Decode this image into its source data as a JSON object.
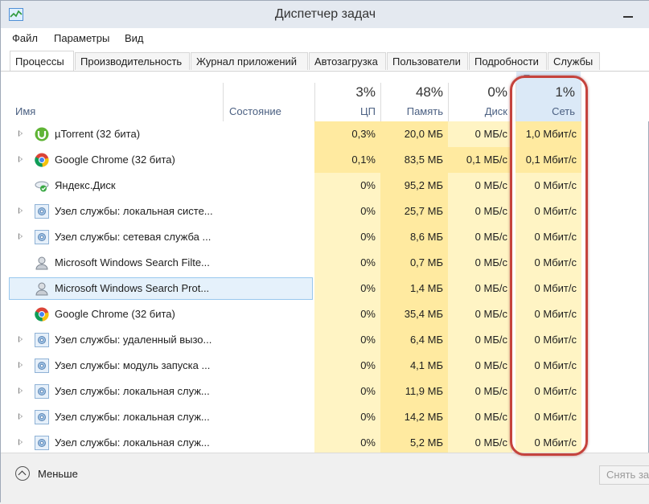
{
  "window": {
    "title": "Диспетчер задач"
  },
  "menu": [
    "Файл",
    "Параметры",
    "Вид"
  ],
  "tabs": [
    "Процессы",
    "Производительность",
    "Журнал приложений",
    "Автозагрузка",
    "Пользователи",
    "Подробности",
    "Службы"
  ],
  "columns": {
    "name": "Имя",
    "status": "Состояние",
    "cpu": {
      "percent": "3%",
      "label": "ЦП"
    },
    "memory": {
      "percent": "48%",
      "label": "Память"
    },
    "disk": {
      "percent": "0%",
      "label": "Диск"
    },
    "network": {
      "percent": "1%",
      "label": "Сеть"
    }
  },
  "processes": [
    {
      "name": "µTorrent (32 бита)",
      "cpu": "0,3%",
      "memory": "20,0 МБ",
      "disk": "0 МБ/с",
      "network": "1,0 Мбит/с",
      "icon": "utorrent-icon",
      "expandable": true
    },
    {
      "name": "Google Chrome (32 бита)",
      "cpu": "0,1%",
      "memory": "83,5 МБ",
      "disk": "0,1 МБ/с",
      "network": "0,1 Мбит/с",
      "icon": "chrome-icon",
      "expandable": true
    },
    {
      "name": "Яндекс.Диск",
      "cpu": "0%",
      "memory": "95,2 МБ",
      "disk": "0 МБ/с",
      "network": "0 Мбит/с",
      "icon": "yandex-disk-icon",
      "expandable": false
    },
    {
      "name": "Узел службы: локальная систе...",
      "cpu": "0%",
      "memory": "25,7 МБ",
      "disk": "0 МБ/с",
      "network": "0 Мбит/с",
      "icon": "service-host-icon",
      "expandable": true
    },
    {
      "name": "Узел службы: сетевая служба ...",
      "cpu": "0%",
      "memory": "8,6 МБ",
      "disk": "0 МБ/с",
      "network": "0 Мбит/с",
      "icon": "service-host-icon",
      "expandable": true
    },
    {
      "name": "Microsoft Windows Search Filte...",
      "cpu": "0%",
      "memory": "0,7 МБ",
      "disk": "0 МБ/с",
      "network": "0 Мбит/с",
      "icon": "search-user-icon",
      "expandable": false
    },
    {
      "name": "Microsoft Windows Search Prot...",
      "cpu": "0%",
      "memory": "1,4 МБ",
      "disk": "0 МБ/с",
      "network": "0 Мбит/с",
      "icon": "search-user-icon",
      "expandable": false,
      "selected": true
    },
    {
      "name": "Google Chrome (32 бита)",
      "cpu": "0%",
      "memory": "35,4 МБ",
      "disk": "0 МБ/с",
      "network": "0 Мбит/с",
      "icon": "chrome-icon",
      "expandable": false
    },
    {
      "name": "Узел службы: удаленный вызо...",
      "cpu": "0%",
      "memory": "6,4 МБ",
      "disk": "0 МБ/с",
      "network": "0 Мбит/с",
      "icon": "service-host-icon",
      "expandable": true
    },
    {
      "name": "Узел службы: модуль запуска ...",
      "cpu": "0%",
      "memory": "4,1 МБ",
      "disk": "0 МБ/с",
      "network": "0 Мбит/с",
      "icon": "service-host-icon",
      "expandable": true
    },
    {
      "name": "Узел службы: локальная служ...",
      "cpu": "0%",
      "memory": "11,9 МБ",
      "disk": "0 МБ/с",
      "network": "0 Мбит/с",
      "icon": "service-host-icon",
      "expandable": true
    },
    {
      "name": "Узел службы: локальная служ...",
      "cpu": "0%",
      "memory": "14,2 МБ",
      "disk": "0 МБ/с",
      "network": "0 Мбит/с",
      "icon": "service-host-icon",
      "expandable": true
    },
    {
      "name": "Узел службы: локальная служ...",
      "cpu": "0%",
      "memory": "5,2 МБ",
      "disk": "0 МБ/с",
      "network": "0 Мбит/с",
      "icon": "service-host-icon",
      "expandable": true
    }
  ],
  "footer": {
    "less_label": "Меньше",
    "end_task_label": "Снять зад"
  },
  "colors": {
    "heat_light": "#fff4c4",
    "heat_medium": "#ffeaa0",
    "network_header": "#dbe9f7",
    "highlight_border": "#c5433d"
  }
}
